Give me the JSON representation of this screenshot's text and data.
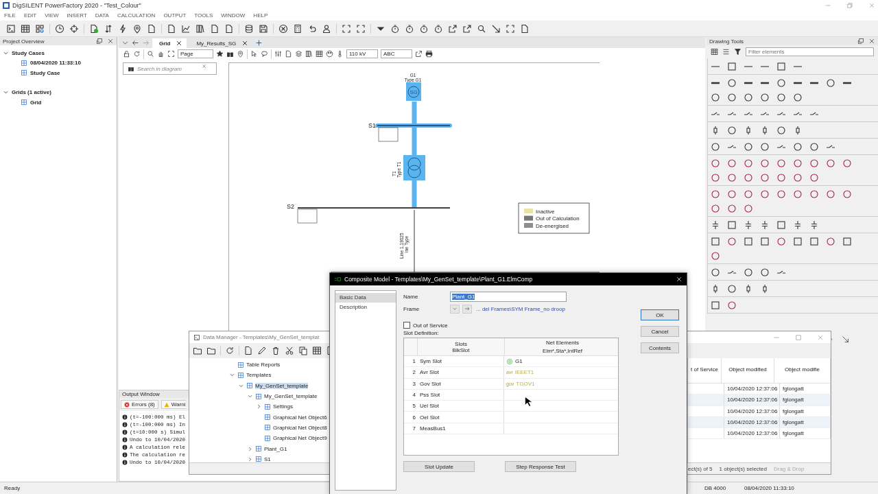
{
  "app": {
    "title": "DigSILENT PowerFactory 2020  - \"Test_Colour\""
  },
  "menu": [
    "FILE",
    "EDIT",
    "VIEW",
    "INSERT",
    "DATA",
    "CALCULATION",
    "OUTPUT",
    "TOOLS",
    "WINDOW",
    "HELP"
  ],
  "project_overview": {
    "title": "Project Overview",
    "tree": [
      {
        "label": "Study Cases",
        "kind": "node",
        "expanded": true,
        "selected": false,
        "children": [
          {
            "label": "08/04/2020 11:33:10",
            "kind": "leaf",
            "selected": false
          },
          {
            "label": "Study Case",
            "kind": "leaf",
            "selected": false
          }
        ]
      },
      {
        "label": "Grids (1 active)",
        "kind": "node",
        "expanded": true,
        "selected": false,
        "children": [
          {
            "label": "Grid",
            "kind": "leaf",
            "selected": false
          }
        ]
      }
    ]
  },
  "diagram_tabs": [
    {
      "label": "Grid",
      "selected": true
    },
    {
      "label": "My_Results_SG",
      "selected": false
    }
  ],
  "diagram_toolbar": {
    "zoom_mode": "Page",
    "voltage": "110 kV",
    "label_mode": "ABC"
  },
  "search": {
    "placeholder": "Search in diagram"
  },
  "diagram": {
    "generator": {
      "name": "G1",
      "type": "Type G1",
      "symbol": "SG"
    },
    "bus_1": "S1",
    "transformer": {
      "name": "T1",
      "type": "Type T1"
    },
    "bus_2": "S2",
    "line": {
      "name": "Line 1.19025",
      "type": "ine Type"
    },
    "legend": [
      {
        "label": "Inactive",
        "color": "#e8e4a8"
      },
      {
        "label": "Out of Calculation",
        "color": "#777777"
      },
      {
        "label": "De-energised",
        "color": "#8e8e8e"
      }
    ]
  },
  "output_window": {
    "title": "Output Window",
    "tabs": [
      {
        "label": "Errors (8)",
        "kind": "error"
      },
      {
        "label": "Warni",
        "kind": "warning"
      }
    ],
    "lines": [
      "(t=-100:000 ms) El",
      "(t=-100:000 ms) In",
      "(t=10:000 s) Simul",
      "Undo to 10/04/2020",
      "A calculation rele",
      "The calculation re",
      "Undo to 10/04/2020"
    ]
  },
  "drawing_tools": {
    "title": "Drawing Tools",
    "filter_placeholder": "Filter elements"
  },
  "data_manager": {
    "title": "Data Manager - Templates\\My_GenSet_templat",
    "tree": [
      {
        "label": "Table Reports",
        "kind": "leaf",
        "selected": false
      },
      {
        "label": "Templates",
        "kind": "node",
        "expanded": true,
        "selected": false,
        "children": [
          {
            "label": "My_GenSet_template",
            "kind": "node",
            "expanded": true,
            "selected": true,
            "children": [
              {
                "label": "My_GenSet_template",
                "kind": "node",
                "expanded": true,
                "selected": false,
                "children": [
                  {
                    "label": "Settings",
                    "kind": "node",
                    "expanded": false,
                    "selected": false
                  },
                  {
                    "label": "Graphical Net Object6",
                    "kind": "leaf",
                    "selected": false
                  },
                  {
                    "label": "Graphical Net Object8",
                    "kind": "leaf",
                    "selected": false
                  },
                  {
                    "label": "Graphical Net Object9",
                    "kind": "leaf",
                    "selected": false
                  }
                ]
              },
              {
                "label": "Plant_G1",
                "kind": "node",
                "expanded": false,
                "selected": false
              },
              {
                "label": "S1",
                "kind": "node",
                "expanded": false,
                "selected": false
              }
            ]
          }
        ]
      }
    ],
    "columns": [
      "t of Service",
      "Object modified",
      "Object modifie"
    ],
    "rows": [
      {
        "modified": "10/04/2020 12:37:06",
        "modified_by": "fglongatt"
      },
      {
        "modified": "10/04/2020 12:37:06",
        "modified_by": "fglongatt"
      },
      {
        "modified": "10/04/2020 12:37:06",
        "modified_by": "fglongatt"
      },
      {
        "modified": "10/04/2020 12:37:06",
        "modified_by": "fglongatt"
      },
      {
        "modified": "10/04/2020 12:37:06",
        "modified_by": "fglongatt"
      }
    ],
    "status": [
      "ect(s) of 5",
      "1 object(s) selected",
      "Drag & Drop"
    ]
  },
  "composite_dialog": {
    "title": "Composite Model - Templates\\My_GenSet_template\\Plant_G1.ElmComp",
    "pages": [
      {
        "label": "Basic Data",
        "selected": true
      },
      {
        "label": "Description",
        "selected": false
      }
    ],
    "name": {
      "label": "Name",
      "value": "Plant_G1",
      "highlighted": true
    },
    "frame": {
      "label": "Frame",
      "value": "... del Frames\\SYM Frame_no droop"
    },
    "out_of_service": {
      "label": "Out of Service",
      "checked": false
    },
    "slot_definition": {
      "label": "Slot Definition:",
      "columns": [
        {
          "title": "Slots",
          "subtitle": "BlkSlot"
        },
        {
          "title": "Net Elements",
          "subtitle": "Elm*,Sta*,IntRef"
        }
      ],
      "rows": [
        {
          "index": "1",
          "slot": "Sym Slot",
          "element": {
            "kind": "generator",
            "name": "G1"
          }
        },
        {
          "index": "2",
          "slot": "Avr Slot",
          "element": {
            "kind": "model",
            "prefix": "avr",
            "name": "IEEET1"
          }
        },
        {
          "index": "3",
          "slot": "Gov Slot",
          "element": {
            "kind": "model",
            "prefix": "gov",
            "name": "TGOV1"
          }
        },
        {
          "index": "4",
          "slot": "Pss Slot"
        },
        {
          "index": "5",
          "slot": "Uel Slot"
        },
        {
          "index": "6",
          "slot": "Oel Slot"
        },
        {
          "index": "7",
          "slot": "MeasBus1"
        }
      ]
    },
    "buttons": [
      "OK",
      "Cancel",
      "Contents"
    ],
    "bottom_buttons": [
      "Slot Update",
      "Step Response Test"
    ]
  },
  "status_bar": {
    "message": "Ready",
    "db": "DB 4000",
    "time": "08/04/2020 11:33:10"
  }
}
